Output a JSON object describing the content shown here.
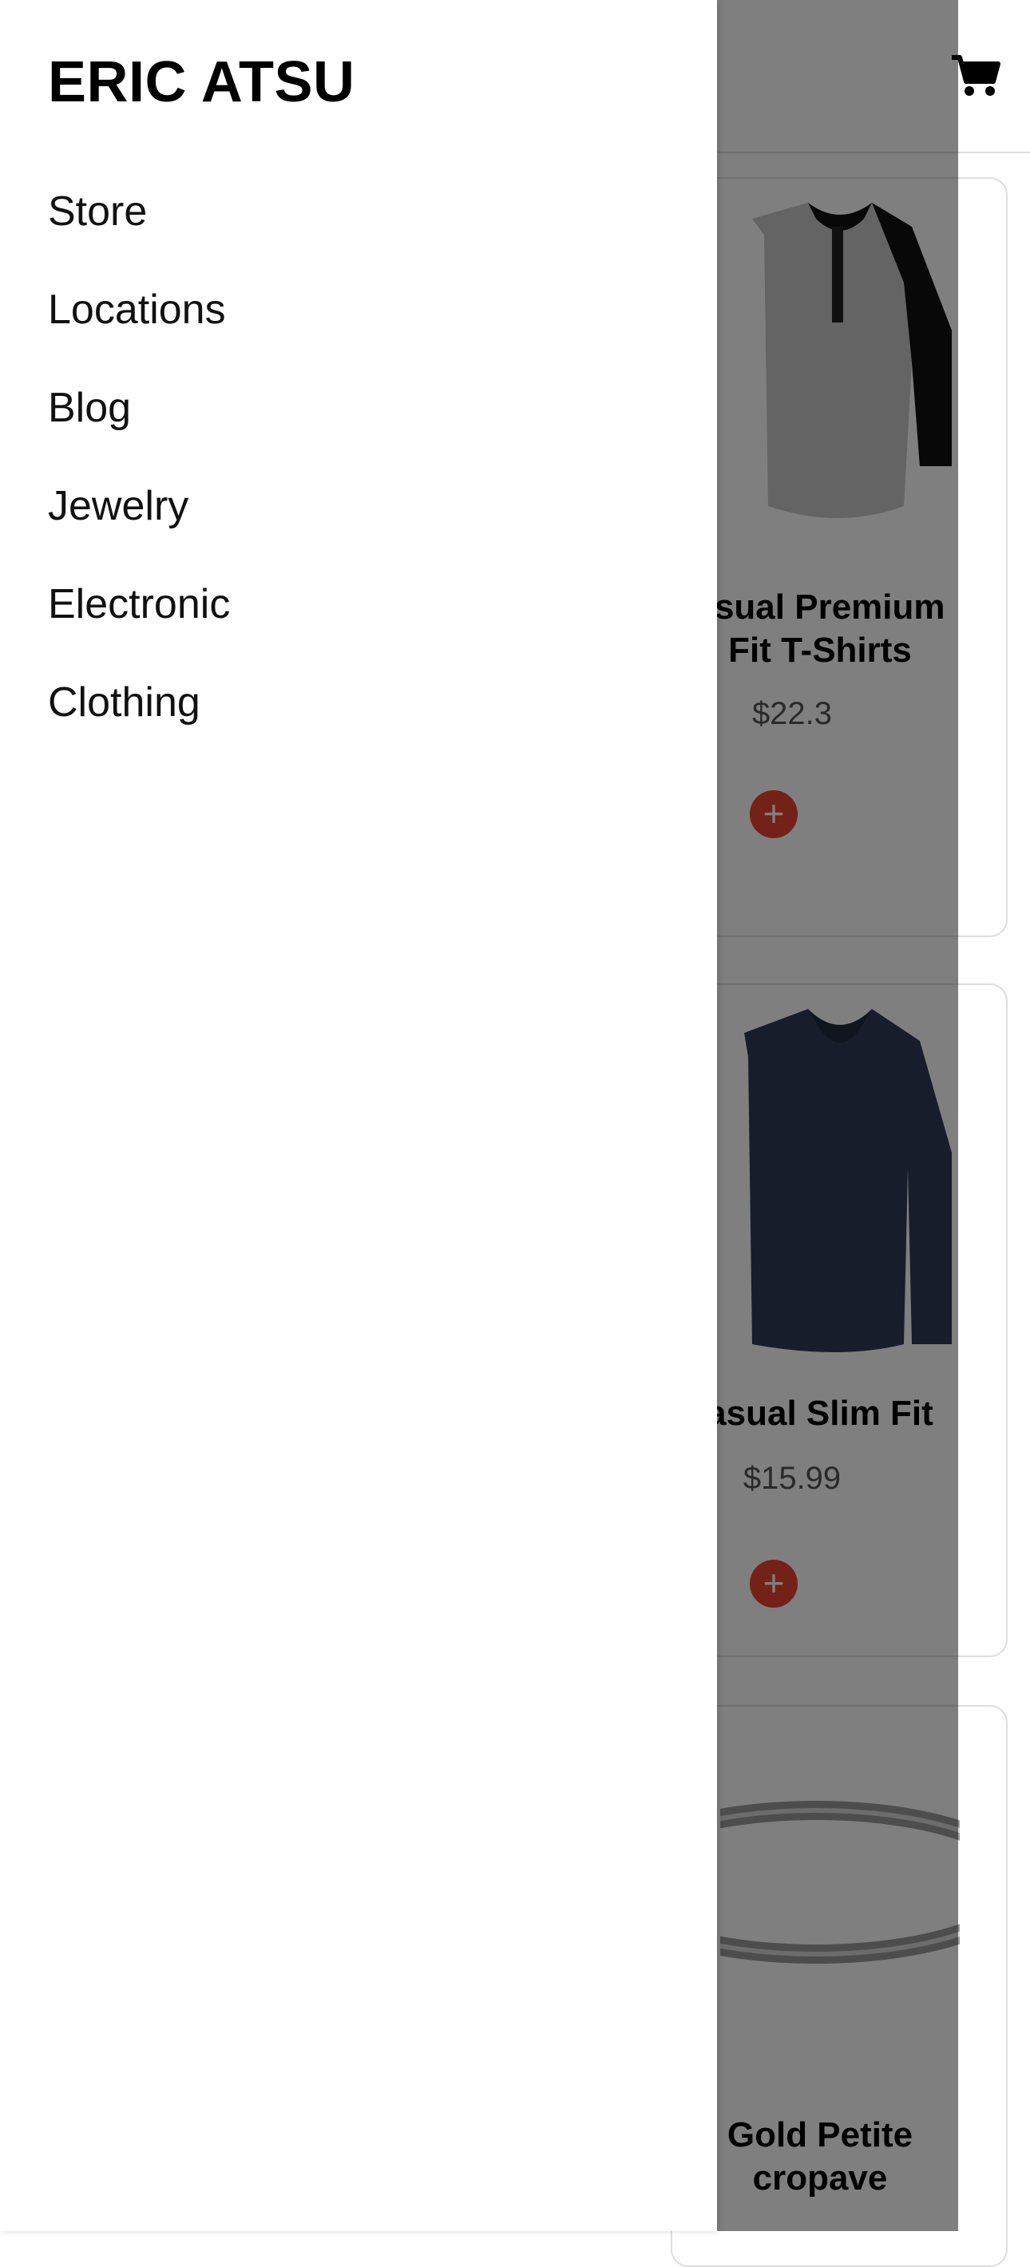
{
  "drawer": {
    "brand": "ERIC ATSU",
    "items": [
      {
        "label": "Store"
      },
      {
        "label": "Locations"
      },
      {
        "label": "Blog"
      },
      {
        "label": "Jewelry"
      },
      {
        "label": "Electronic"
      },
      {
        "label": "Clothing"
      }
    ]
  },
  "header": {
    "cart_icon": "cart-icon"
  },
  "products": [
    {
      "title": "asual Premium\nFit T-Shirts",
      "price": "$22.3",
      "add_icon": "plus-icon"
    },
    {
      "title": "asual Slim Fit",
      "price": "$15.99",
      "add_icon": "plus-icon"
    },
    {
      "title": "Gold Petite\ncropave",
      "price": ""
    }
  ],
  "colors": {
    "accent": "#e8432e",
    "overlay": "rgba(0,0,0,0.5)"
  }
}
